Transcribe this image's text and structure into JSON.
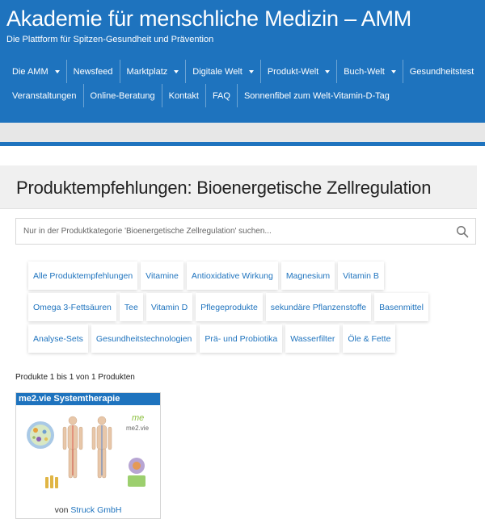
{
  "header": {
    "site_title": "Akademie für menschliche Medizin – AMM",
    "tagline": "Die Plattform für Spitzen-Gesundheit und Prävention"
  },
  "nav": {
    "row1": [
      {
        "label": "Die AMM",
        "dropdown": true
      },
      {
        "label": "Newsfeed",
        "dropdown": false
      },
      {
        "label": "Marktplatz",
        "dropdown": true
      },
      {
        "label": "Digitale Welt",
        "dropdown": true
      },
      {
        "label": "Produkt-Welt",
        "dropdown": true
      },
      {
        "label": "Buch-Welt",
        "dropdown": true
      },
      {
        "label": "Gesundheitstest",
        "dropdown": false
      }
    ],
    "row2": [
      {
        "label": "Veranstaltungen"
      },
      {
        "label": "Online-Beratung"
      },
      {
        "label": "Kontakt"
      },
      {
        "label": "FAQ"
      },
      {
        "label": "Sonnenfibel zum Welt-Vitamin-D-Tag"
      }
    ]
  },
  "page": {
    "title": "Produktempfehlungen: Bioenergetische Zellregulation"
  },
  "search": {
    "placeholder": "Nur in der Produktkategorie 'Bioenergetische Zellregulation' suchen...",
    "value": "",
    "icon": "search-icon"
  },
  "tags": {
    "row1": [
      "Alle Produktempfehlungen",
      "Vitamine",
      "Antioxidative Wirkung",
      "Magnesium",
      "Vitamin B"
    ],
    "row2": [
      "Omega 3-Fettsäuren",
      "Tee",
      "Vitamin D",
      "Pflegeprodukte",
      "sekundäre Pflanzenstoffe",
      "Basenmittel"
    ],
    "row3": [
      "Analyse-Sets",
      "Gesundheitstechnologien",
      "Prä- und Probiotika",
      "Wasserfilter",
      "Öle & Fette"
    ]
  },
  "results": {
    "count_text": "Produkte 1 bis 1 von 1 Produkten"
  },
  "product": {
    "title": "me2.vie Systemtherapie",
    "logo_text": "me2.vie",
    "vendor_prefix": "von",
    "vendor_name": "Struck GmbH"
  },
  "colors": {
    "brand_blue": "#1e73be",
    "band_grey": "#e7e7e7",
    "title_box_grey": "#f0f0f0"
  }
}
